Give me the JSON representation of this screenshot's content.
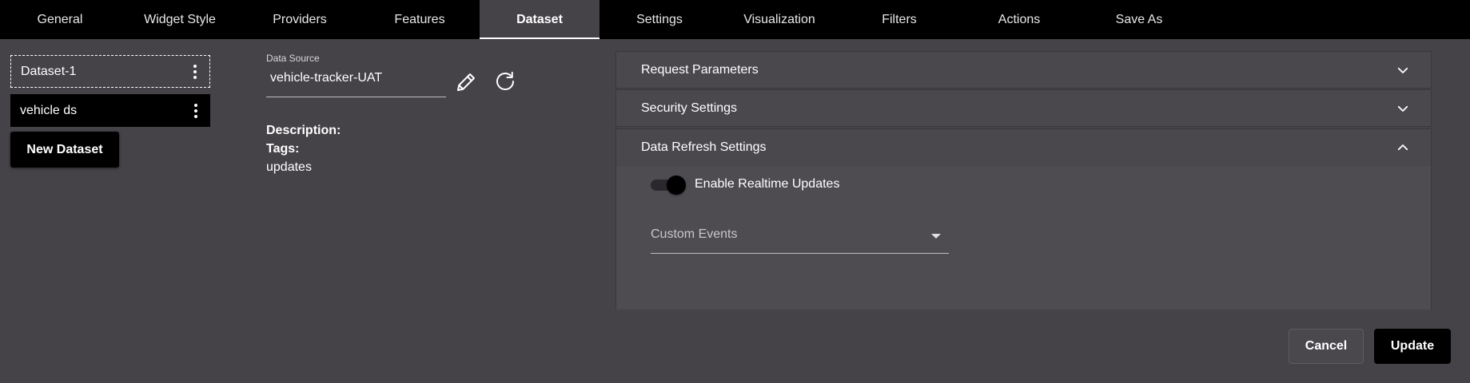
{
  "tabs": [
    {
      "label": "General"
    },
    {
      "label": "Widget Style"
    },
    {
      "label": "Providers"
    },
    {
      "label": "Features"
    },
    {
      "label": "Dataset"
    },
    {
      "label": "Settings"
    },
    {
      "label": "Visualization"
    },
    {
      "label": "Filters"
    },
    {
      "label": "Actions"
    },
    {
      "label": "Save As"
    }
  ],
  "active_tab": "Dataset",
  "datasets": {
    "items": [
      {
        "label": "Dataset-1"
      },
      {
        "label": "vehicle ds"
      }
    ],
    "new_button": "New Dataset"
  },
  "data_source": {
    "label": "Data Source",
    "value": "vehicle-tracker-UAT"
  },
  "meta": {
    "description_label": "Description:",
    "tags_label": "Tags:",
    "tags_value": "updates"
  },
  "accordion": {
    "request_parameters": "Request Parameters",
    "security_settings": "Security Settings",
    "data_refresh_settings": "Data Refresh Settings",
    "realtime_label": "Enable Realtime Updates",
    "custom_events_placeholder": "Custom Events"
  },
  "footer": {
    "cancel": "Cancel",
    "update": "Update"
  }
}
